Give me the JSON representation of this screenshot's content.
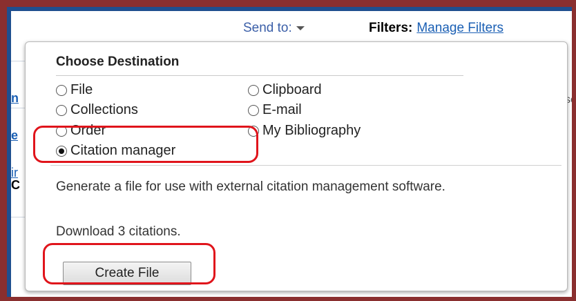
{
  "toolbar": {
    "send_to_label": "Send to:",
    "filters_label": "Filters:",
    "manage_filters_link": "Manage Filters"
  },
  "background_fragments": {
    "frag1": "n",
    "frag2": "e",
    "frag3": "ir",
    "frag4": "C",
    "right1": "se"
  },
  "popup": {
    "heading": "Choose Destination",
    "options": [
      {
        "label": "File",
        "selected": false
      },
      {
        "label": "Clipboard",
        "selected": false
      },
      {
        "label": "Collections",
        "selected": false
      },
      {
        "label": "E-mail",
        "selected": false
      },
      {
        "label": "Order",
        "selected": false
      },
      {
        "label": "My Bibliography",
        "selected": false
      },
      {
        "label": "Citation manager",
        "selected": true
      }
    ],
    "description": "Generate a file for use with external citation management software.",
    "download_count": "Download 3 citations.",
    "create_button": "Create File"
  },
  "colors": {
    "outer_frame": "#8a2f2f",
    "inner_border": "#1f4f8f",
    "highlight": "#e0141b",
    "link": "#1a5fb4"
  }
}
